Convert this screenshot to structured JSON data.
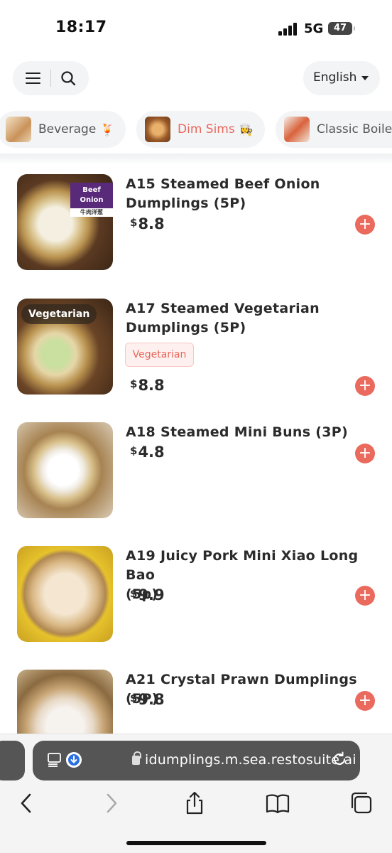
{
  "status_bar": {
    "time": "18:17",
    "network": "5G",
    "battery": "47"
  },
  "header": {
    "language": "English"
  },
  "categories": [
    {
      "label": "Beverage",
      "emoji": "🍹",
      "active": false
    },
    {
      "label": "Dim Sims",
      "emoji": "👩‍🍳",
      "active": true
    },
    {
      "label": "Classic Boile",
      "emoji": "",
      "active": false
    }
  ],
  "menu_items": [
    {
      "name_line1": "A15 Steamed Beef Onion",
      "name_line2": "Dumplings (5P)",
      "currency": "$",
      "price": "8.8",
      "image_badge": "Beef Onion",
      "image_badge_sub": "牛肉洋葱"
    },
    {
      "name_line1": "A17 Steamed Vegetarian",
      "name_line2": "Dumplings (5P)",
      "currency": "$",
      "price": "8.8",
      "image_badge": "Vegetarian",
      "tag": "Vegetarian"
    },
    {
      "name_line1": "A18 Steamed Mini Buns (3P)",
      "currency": "$",
      "price": "4.8"
    },
    {
      "name_line1": "A19 Juicy Pork Mini Xiao Long Bao",
      "name_line2": "(5p)",
      "currency": "$",
      "price": "9.9"
    },
    {
      "name_line1": "A21 Crystal Prawn Dumplings (5P)",
      "currency": "$",
      "price": "9.8"
    }
  ],
  "add_button_label": "+",
  "browser": {
    "url": "idumplings.m.sea.restosuite.ai"
  },
  "colors": {
    "accent": "#e8675a",
    "add_button": "#ea6a5e",
    "pill_bg": "#f3f4f6",
    "url_bar": "#555555"
  }
}
